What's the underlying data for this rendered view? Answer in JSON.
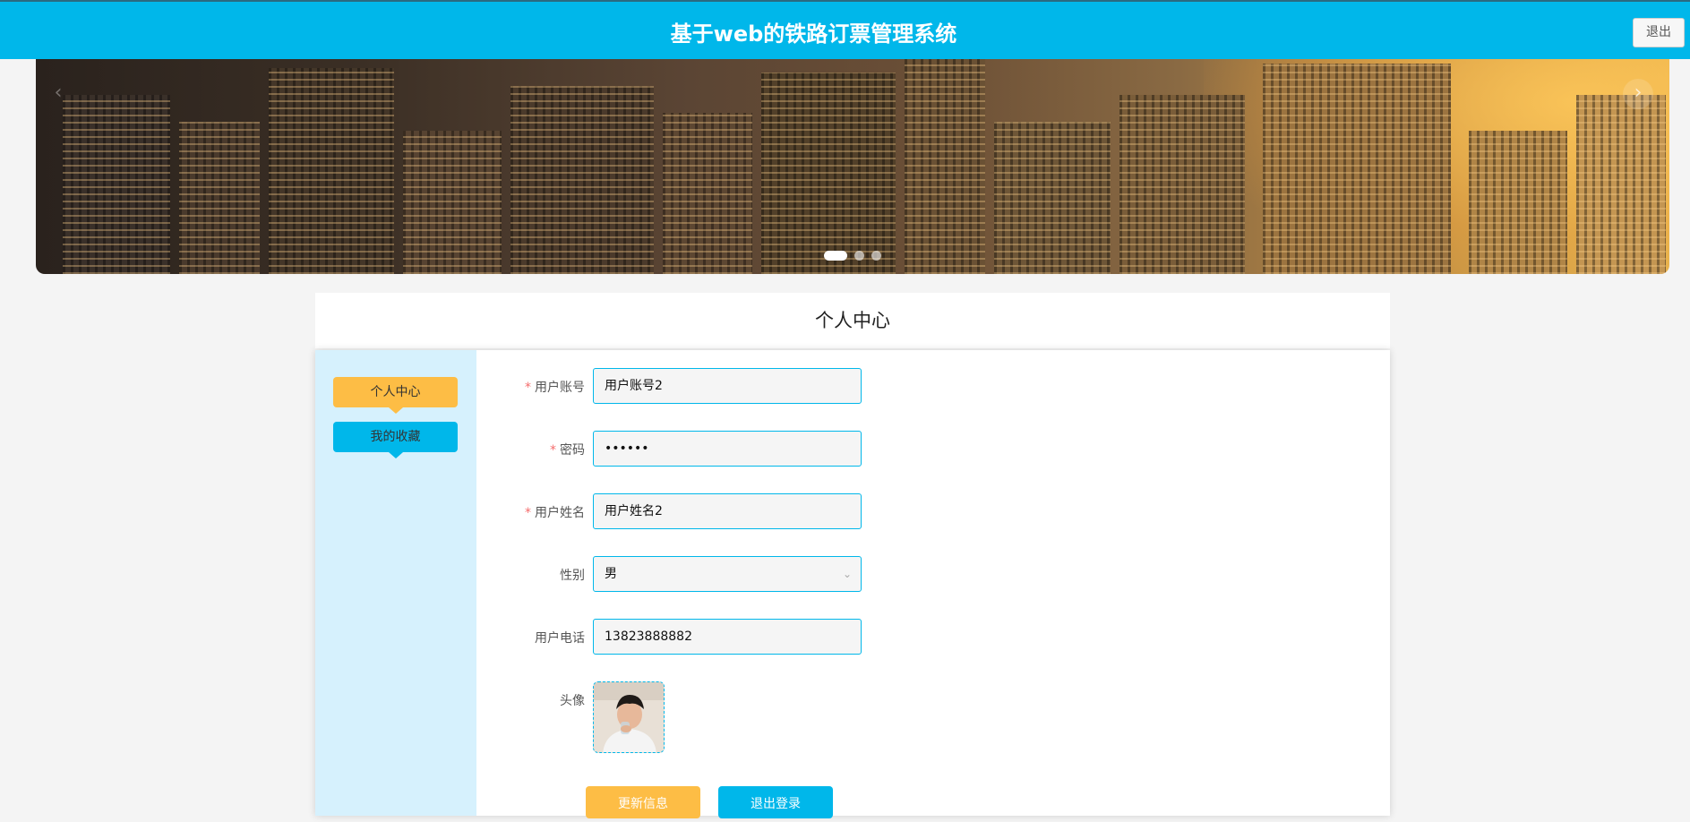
{
  "header": {
    "title": "基于web的铁路订票管理系统",
    "logout_label": "退出"
  },
  "banner": {
    "arrow_left": "‹",
    "arrow_right": "›",
    "slide_count": 3,
    "active_slide": 1
  },
  "page": {
    "section_title": "个人中心"
  },
  "sidebar": {
    "items": [
      {
        "label": "个人中心"
      },
      {
        "label": "我的收藏"
      }
    ]
  },
  "form": {
    "account": {
      "label": "用户账号",
      "value": "用户账号2",
      "required": true
    },
    "password": {
      "label": "密码",
      "value": "••••••",
      "required": true
    },
    "name": {
      "label": "用户姓名",
      "value": "用户姓名2",
      "required": true
    },
    "gender": {
      "label": "性别",
      "value": "男"
    },
    "phone": {
      "label": "用户电话",
      "value": "13823888882"
    },
    "avatar": {
      "label": "头像"
    }
  },
  "actions": {
    "update_label": "更新信息",
    "logout_label": "退出登录"
  },
  "colors": {
    "primary": "#00b7ea",
    "accent": "#fdbd45",
    "sidebar_bg": "#d6f1fd"
  }
}
